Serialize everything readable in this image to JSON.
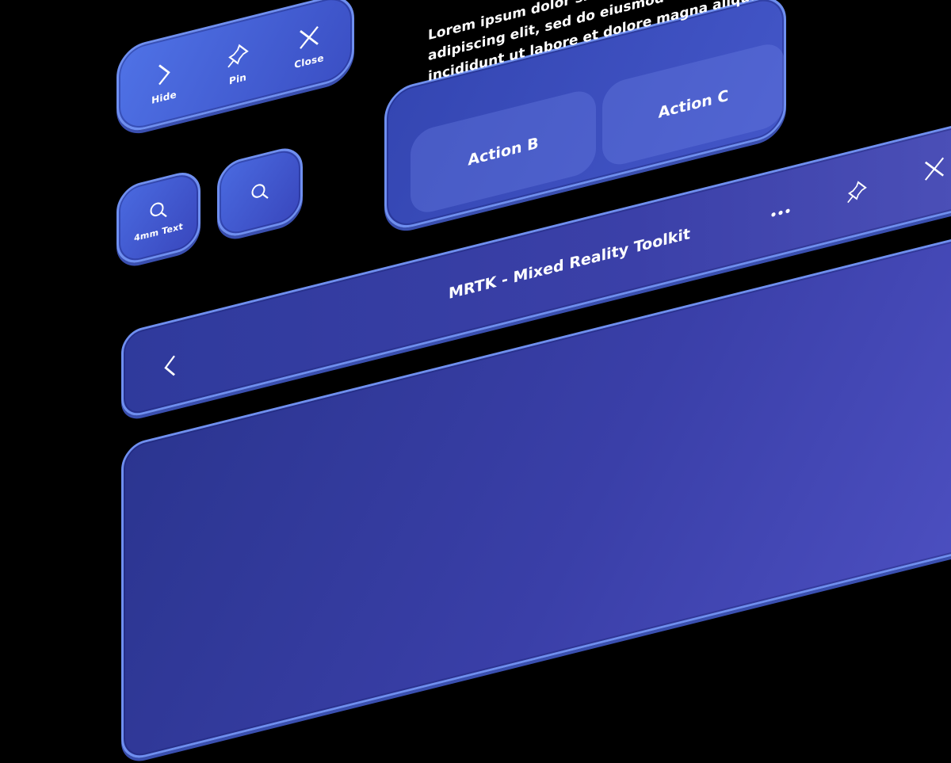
{
  "window_toolbar": {
    "hide_label": "Hide",
    "pin_label": "Pin",
    "close_label": "Close"
  },
  "small_buttons": {
    "text_button_label": "4mm Text"
  },
  "dialog": {
    "body": "Lorem ipsum dolor sit amet, consectetur adipiscing elit, sed do eiusmod tempor incididunt ut labore et dolore magna aliqua.",
    "line1": "Lorem ipsum dolor sit amet,",
    "line2": "adipiscing elit, sed do eiusmod tempor",
    "line3": "incididunt ut labore et dolore magna aliqua.",
    "action_b": "Action B",
    "action_c": "Action C"
  },
  "titlebar": {
    "title": "MRTK - Mixed Reality Toolkit"
  },
  "colors": {
    "panel_light": "#4d6fe0",
    "panel_dark": "#2d3592",
    "border": "#6f8ff0",
    "background": "#000000"
  },
  "icons": [
    "chevron-right-icon",
    "pin-icon",
    "close-icon",
    "search-icon",
    "more-icon",
    "chevron-left-icon"
  ]
}
